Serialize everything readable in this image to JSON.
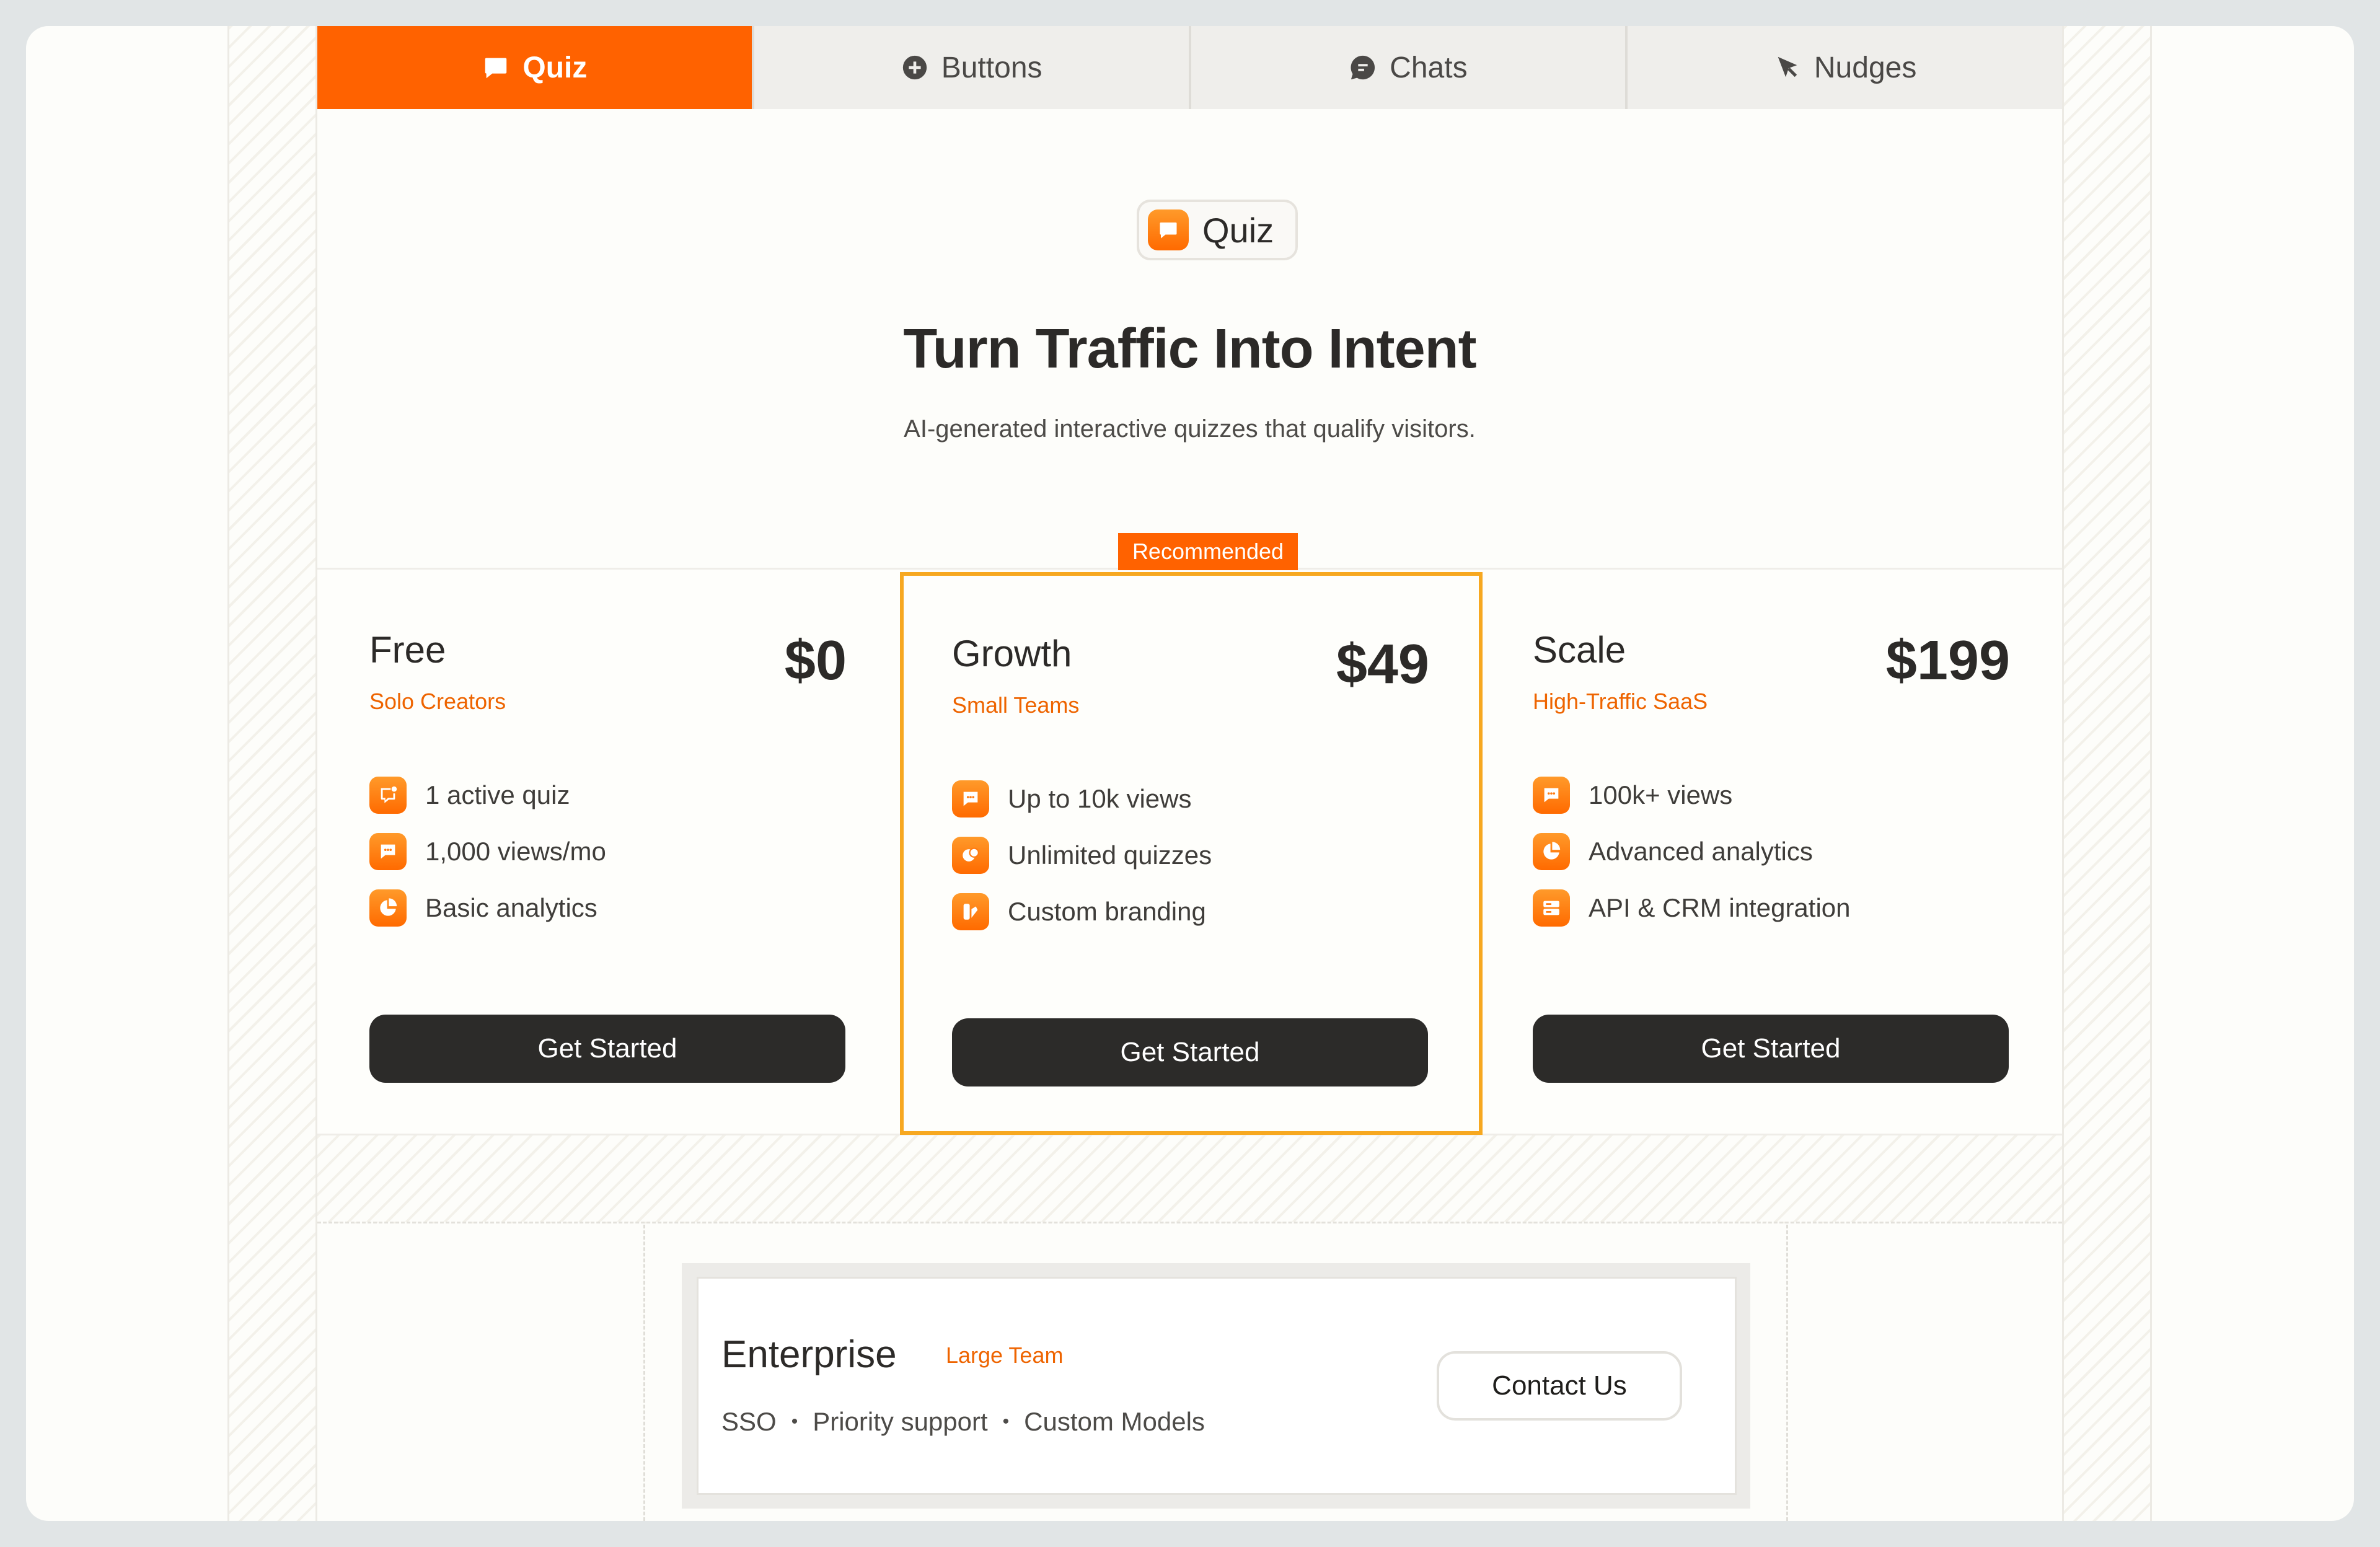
{
  "tabs": [
    {
      "label": "Quiz",
      "icon": "chat-bubble-icon",
      "active": true
    },
    {
      "label": "Buttons",
      "icon": "plus-circle-icon",
      "active": false
    },
    {
      "label": "Chats",
      "icon": "message-circle-icon",
      "active": false
    },
    {
      "label": "Nudges",
      "icon": "cursor-arrow-icon",
      "active": false
    }
  ],
  "hero": {
    "badge": "Quiz",
    "title": "Turn Traffic Into Intent",
    "subtitle": "AI-generated interactive quizzes that qualify visitors."
  },
  "recommended_label": "Recommended",
  "plans": [
    {
      "name": "Free",
      "audience": "Solo Creators",
      "price": "$0",
      "features": [
        {
          "text": "1 active quiz",
          "icon": "chat-alert-icon"
        },
        {
          "text": "1,000 views/mo",
          "icon": "chat-bubble-icon"
        },
        {
          "text": "Basic analytics",
          "icon": "pie-chart-icon"
        }
      ],
      "cta": "Get Started"
    },
    {
      "name": "Growth",
      "audience": "Small Teams",
      "price": "$49",
      "features": [
        {
          "text": "Up to 10k views",
          "icon": "chat-bubble-icon"
        },
        {
          "text": "Unlimited quizzes",
          "icon": "chats-icon"
        },
        {
          "text": "Custom branding",
          "icon": "palette-icon"
        }
      ],
      "cta": "Get Started"
    },
    {
      "name": "Scale",
      "audience": "High-Traffic SaaS",
      "price": "$199",
      "features": [
        {
          "text": "100k+ views",
          "icon": "chat-bubble-icon"
        },
        {
          "text": "Advanced analytics",
          "icon": "pie-chart-icon"
        },
        {
          "text": "API & CRM integration",
          "icon": "server-icon"
        }
      ],
      "cta": "Get Started"
    }
  ],
  "enterprise": {
    "name": "Enterprise",
    "tag": "Large Team",
    "features": [
      "SSO",
      "Priority support",
      "Custom Models"
    ],
    "cta": "Contact Us"
  },
  "colors": {
    "accent": "#ff6200",
    "recommended_border": "#f7a820",
    "dark_button": "#2c2b29"
  }
}
